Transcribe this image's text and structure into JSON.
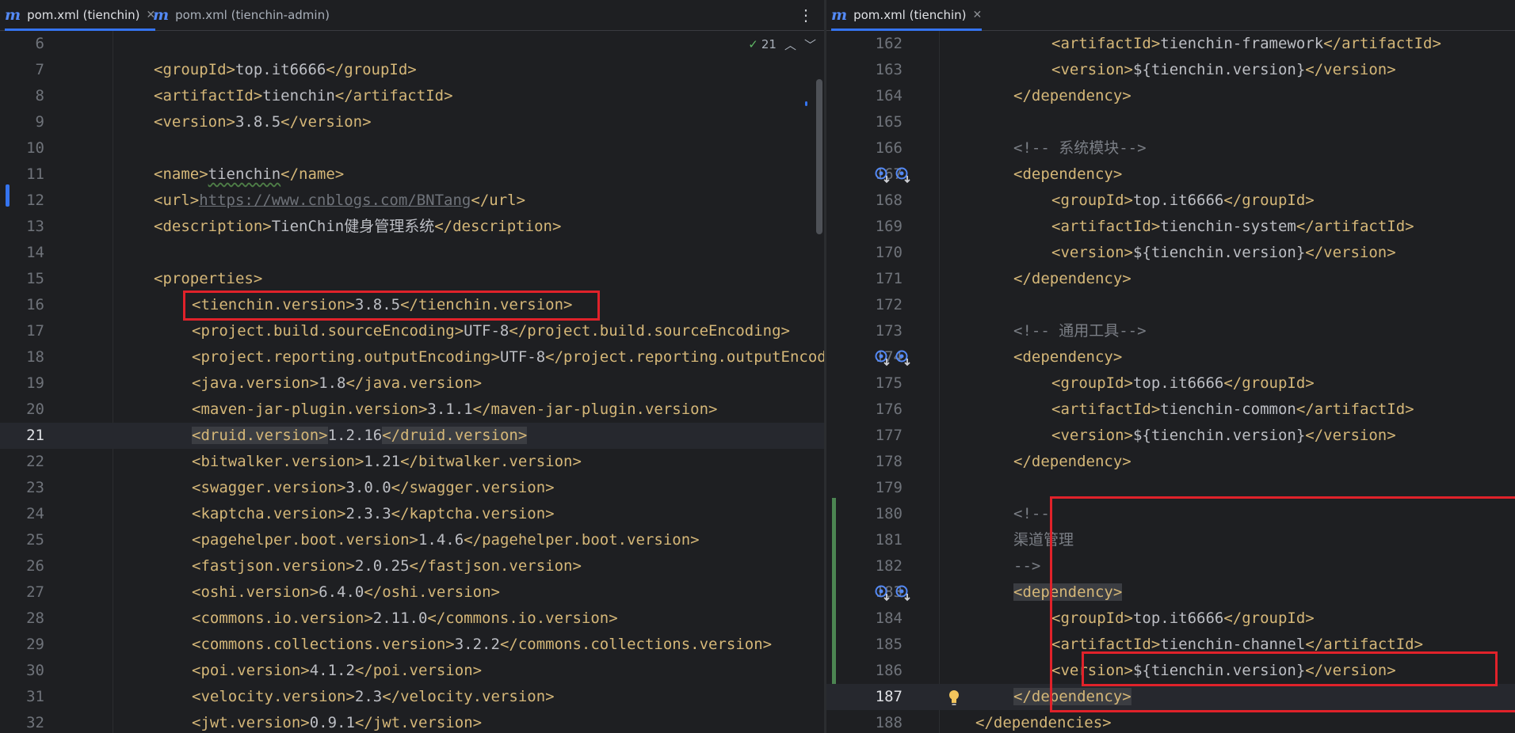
{
  "left": {
    "tabs": [
      {
        "icon": "m",
        "label": "pom.xml (tienchin)",
        "active": true,
        "closable": true
      },
      {
        "icon": "m",
        "label": "pom.xml (tienchin-admin)",
        "active": false,
        "closable": false
      }
    ],
    "more_icon": "⋮",
    "inspection": {
      "check_glyph": "✓",
      "count": "21",
      "up_glyph": "︿",
      "down_glyph": "﹀"
    },
    "lines": [
      {
        "n": "6",
        "indent": 0,
        "parts": []
      },
      {
        "n": "7",
        "indent": 1,
        "parts": [
          [
            "tg",
            "<groupId>"
          ],
          [
            "tx",
            "top.it6666"
          ],
          [
            "tg",
            "</groupId>"
          ]
        ]
      },
      {
        "n": "8",
        "indent": 1,
        "parts": [
          [
            "tg",
            "<artifactId>"
          ],
          [
            "tx",
            "tienchin"
          ],
          [
            "tg",
            "</artifactId>"
          ]
        ]
      },
      {
        "n": "9",
        "indent": 1,
        "parts": [
          [
            "tg",
            "<version>"
          ],
          [
            "tx",
            "3.8.5"
          ],
          [
            "tg",
            "</version>"
          ]
        ]
      },
      {
        "n": "10",
        "indent": 0,
        "parts": []
      },
      {
        "n": "11",
        "indent": 1,
        "parts": [
          [
            "tg",
            "<name>"
          ],
          [
            "tx wavy",
            "tienchin"
          ],
          [
            "tg",
            "</name>"
          ]
        ]
      },
      {
        "n": "12",
        "indent": 1,
        "parts": [
          [
            "tg",
            "<url>"
          ],
          [
            "url",
            "https://www.cnblogs.com/BNTang"
          ],
          [
            "tg",
            "</url>"
          ]
        ]
      },
      {
        "n": "13",
        "indent": 1,
        "parts": [
          [
            "tg",
            "<description>"
          ],
          [
            "tx",
            "TienChin健身管理系统"
          ],
          [
            "tg",
            "</description>"
          ]
        ]
      },
      {
        "n": "14",
        "indent": 0,
        "parts": []
      },
      {
        "n": "15",
        "indent": 1,
        "parts": [
          [
            "tg",
            "<properties>"
          ]
        ]
      },
      {
        "n": "16",
        "indent": 2,
        "parts": [
          [
            "tg",
            "<tienchin.version>"
          ],
          [
            "tx",
            "3.8.5"
          ],
          [
            "tg",
            "</tienchin.version>"
          ]
        ]
      },
      {
        "n": "17",
        "indent": 2,
        "parts": [
          [
            "tg",
            "<project.build.sourceEncoding>"
          ],
          [
            "tx",
            "UTF-8"
          ],
          [
            "tg",
            "</project.build.sourceEncoding>"
          ]
        ]
      },
      {
        "n": "18",
        "indent": 2,
        "parts": [
          [
            "tg",
            "<project.reporting.outputEncoding>"
          ],
          [
            "tx",
            "UTF-8"
          ],
          [
            "tg",
            "</project.reporting.outputEncoding>"
          ]
        ]
      },
      {
        "n": "19",
        "indent": 2,
        "parts": [
          [
            "tg",
            "<java.version>"
          ],
          [
            "tx",
            "1.8"
          ],
          [
            "tg",
            "</java.version>"
          ]
        ]
      },
      {
        "n": "20",
        "indent": 2,
        "parts": [
          [
            "tg",
            "<maven-jar-plugin.version>"
          ],
          [
            "tx",
            "3.1.1"
          ],
          [
            "tg",
            "</maven-jar-plugin.version>"
          ]
        ]
      },
      {
        "n": "21",
        "indent": 2,
        "current": true,
        "parts": [
          [
            "tg hl",
            "<druid.version>"
          ],
          [
            "tx",
            "1.2.16"
          ],
          [
            "tg hl",
            "</druid.version>"
          ]
        ]
      },
      {
        "n": "22",
        "indent": 2,
        "parts": [
          [
            "tg",
            "<bitwalker.version>"
          ],
          [
            "tx",
            "1.21"
          ],
          [
            "tg",
            "</bitwalker.version>"
          ]
        ]
      },
      {
        "n": "23",
        "indent": 2,
        "parts": [
          [
            "tg",
            "<swagger.version>"
          ],
          [
            "tx",
            "3.0.0"
          ],
          [
            "tg",
            "</swagger.version>"
          ]
        ]
      },
      {
        "n": "24",
        "indent": 2,
        "parts": [
          [
            "tg",
            "<kaptcha.version>"
          ],
          [
            "tx",
            "2.3.3"
          ],
          [
            "tg",
            "</kaptcha.version>"
          ]
        ]
      },
      {
        "n": "25",
        "indent": 2,
        "parts": [
          [
            "tg",
            "<pagehelper.boot.version>"
          ],
          [
            "tx",
            "1.4.6"
          ],
          [
            "tg",
            "</pagehelper.boot.version>"
          ]
        ]
      },
      {
        "n": "26",
        "indent": 2,
        "parts": [
          [
            "tg",
            "<fastjson.version>"
          ],
          [
            "tx",
            "2.0.25"
          ],
          [
            "tg",
            "</fastjson.version>"
          ]
        ]
      },
      {
        "n": "27",
        "indent": 2,
        "parts": [
          [
            "tg",
            "<oshi.version>"
          ],
          [
            "tx",
            "6.4.0"
          ],
          [
            "tg",
            "</oshi.version>"
          ]
        ]
      },
      {
        "n": "28",
        "indent": 2,
        "parts": [
          [
            "tg",
            "<commons.io.version>"
          ],
          [
            "tx",
            "2.11.0"
          ],
          [
            "tg",
            "</commons.io.version>"
          ]
        ]
      },
      {
        "n": "29",
        "indent": 2,
        "parts": [
          [
            "tg",
            "<commons.collections.version>"
          ],
          [
            "tx",
            "3.2.2"
          ],
          [
            "tg",
            "</commons.collections.version>"
          ]
        ]
      },
      {
        "n": "30",
        "indent": 2,
        "parts": [
          [
            "tg",
            "<poi.version>"
          ],
          [
            "tx",
            "4.1.2"
          ],
          [
            "tg",
            "</poi.version>"
          ]
        ]
      },
      {
        "n": "31",
        "indent": 2,
        "parts": [
          [
            "tg",
            "<velocity.version>"
          ],
          [
            "tx",
            "2.3"
          ],
          [
            "tg",
            "</velocity.version>"
          ]
        ]
      },
      {
        "n": "32",
        "indent": 2,
        "parts": [
          [
            "tg",
            "<jwt.version>"
          ],
          [
            "tx",
            "0.9.1"
          ],
          [
            "tg",
            "</jwt.version>"
          ]
        ]
      }
    ]
  },
  "right": {
    "tabs": [
      {
        "icon": "m",
        "label": "pom.xml (tienchin)",
        "active": true,
        "closable": true
      }
    ],
    "lines": [
      {
        "n": "162",
        "indent": 3,
        "parts": [
          [
            "tg",
            "<artifactId>"
          ],
          [
            "tx",
            "tienchin-framework"
          ],
          [
            "tg",
            "</artifactId>"
          ]
        ]
      },
      {
        "n": "163",
        "indent": 3,
        "parts": [
          [
            "tg",
            "<version>"
          ],
          [
            "tx",
            "${tienchin.version}"
          ],
          [
            "tg",
            "</version>"
          ]
        ]
      },
      {
        "n": "164",
        "indent": 2,
        "parts": [
          [
            "tg",
            "</dependency>"
          ]
        ]
      },
      {
        "n": "165",
        "indent": 0,
        "parts": []
      },
      {
        "n": "166",
        "indent": 2,
        "parts": [
          [
            "cm",
            "<!-- 系统模块-->"
          ]
        ]
      },
      {
        "n": "167",
        "indent": 2,
        "icons": true,
        "parts": [
          [
            "tg",
            "<dependency>"
          ]
        ]
      },
      {
        "n": "168",
        "indent": 3,
        "parts": [
          [
            "tg",
            "<groupId>"
          ],
          [
            "tx",
            "top.it6666"
          ],
          [
            "tg",
            "</groupId>"
          ]
        ]
      },
      {
        "n": "169",
        "indent": 3,
        "parts": [
          [
            "tg",
            "<artifactId>"
          ],
          [
            "tx",
            "tienchin-system"
          ],
          [
            "tg",
            "</artifactId>"
          ]
        ]
      },
      {
        "n": "170",
        "indent": 3,
        "parts": [
          [
            "tg",
            "<version>"
          ],
          [
            "tx",
            "${tienchin.version}"
          ],
          [
            "tg",
            "</version>"
          ]
        ]
      },
      {
        "n": "171",
        "indent": 2,
        "parts": [
          [
            "tg",
            "</dependency>"
          ]
        ]
      },
      {
        "n": "172",
        "indent": 0,
        "parts": []
      },
      {
        "n": "173",
        "indent": 2,
        "parts": [
          [
            "cm",
            "<!-- 通用工具-->"
          ]
        ]
      },
      {
        "n": "174",
        "indent": 2,
        "icons": true,
        "parts": [
          [
            "tg",
            "<dependency>"
          ]
        ]
      },
      {
        "n": "175",
        "indent": 3,
        "parts": [
          [
            "tg",
            "<groupId>"
          ],
          [
            "tx",
            "top.it6666"
          ],
          [
            "tg",
            "</groupId>"
          ]
        ]
      },
      {
        "n": "176",
        "indent": 3,
        "parts": [
          [
            "tg",
            "<artifactId>"
          ],
          [
            "tx",
            "tienchin-common"
          ],
          [
            "tg",
            "</artifactId>"
          ]
        ]
      },
      {
        "n": "177",
        "indent": 3,
        "parts": [
          [
            "tg",
            "<version>"
          ],
          [
            "tx",
            "${tienchin.version}"
          ],
          [
            "tg",
            "</version>"
          ]
        ]
      },
      {
        "n": "178",
        "indent": 2,
        "parts": [
          [
            "tg",
            "</dependency>"
          ]
        ]
      },
      {
        "n": "179",
        "indent": 0,
        "parts": []
      },
      {
        "n": "180",
        "indent": 2,
        "parts": [
          [
            "cm",
            "<!--"
          ]
        ]
      },
      {
        "n": "181",
        "indent": 2,
        "parts": [
          [
            "cm",
            "渠道管理"
          ]
        ]
      },
      {
        "n": "182",
        "indent": 2,
        "parts": [
          [
            "cm",
            "-->"
          ]
        ]
      },
      {
        "n": "183",
        "indent": 2,
        "icons": true,
        "parts": [
          [
            "tg hl",
            "<dependency>"
          ]
        ]
      },
      {
        "n": "184",
        "indent": 3,
        "parts": [
          [
            "tg",
            "<groupId>"
          ],
          [
            "tx",
            "top.it6666"
          ],
          [
            "tg",
            "</groupId>"
          ]
        ]
      },
      {
        "n": "185",
        "indent": 3,
        "parts": [
          [
            "tg",
            "<artifactId>"
          ],
          [
            "tx",
            "tienchin-channel"
          ],
          [
            "tg",
            "</artifactId>"
          ]
        ]
      },
      {
        "n": "186",
        "indent": 3,
        "parts": [
          [
            "tg",
            "<version>"
          ],
          [
            "tx",
            "${tienchin.version}"
          ],
          [
            "tg",
            "</version>"
          ]
        ]
      },
      {
        "n": "187",
        "indent": 2,
        "current": true,
        "bulb": true,
        "parts": [
          [
            "tg hl",
            "</dependency>"
          ]
        ]
      },
      {
        "n": "188",
        "indent": 1,
        "parts": [
          [
            "tg",
            "</dependencies>"
          ]
        ]
      }
    ]
  },
  "colors": {
    "tag": "#d5b778",
    "text": "#bcbec4",
    "comment": "#7a7e85",
    "annotation": "#e0222a",
    "change_bar": "#4c8552",
    "accent": "#3574f0"
  }
}
